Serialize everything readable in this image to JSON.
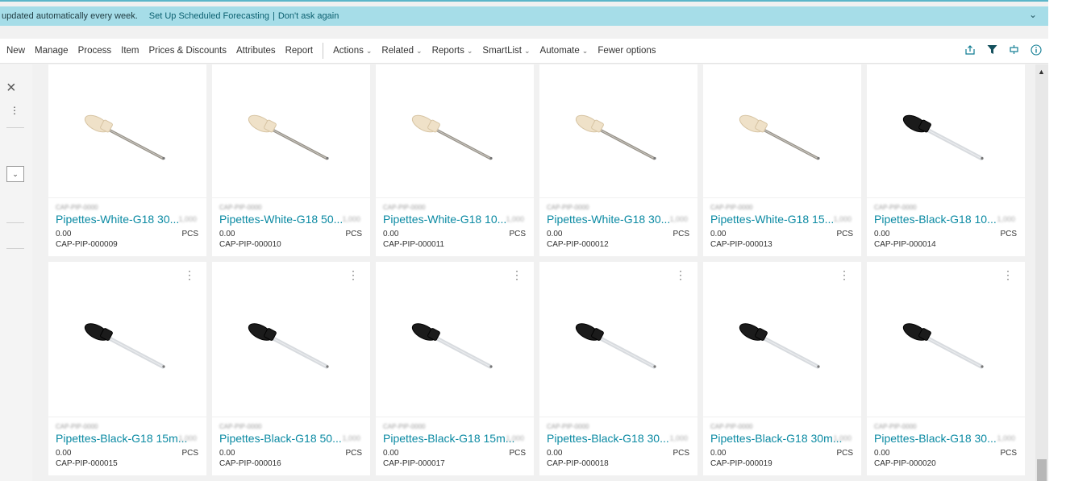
{
  "banner": {
    "message": "updated automatically every week.",
    "setup_link": "Set Up Scheduled Forecasting",
    "divider": "|",
    "dismiss_link": "Don't ask again"
  },
  "actions": {
    "new": "New",
    "manage": "Manage",
    "process": "Process",
    "item": "Item",
    "prices": "Prices & Discounts",
    "attributes": "Attributes",
    "report": "Report",
    "actions_menu": "Actions",
    "related": "Related",
    "reports": "Reports",
    "smartlist": "SmartList",
    "automate": "Automate",
    "fewer": "Fewer options"
  },
  "accent_color": "#0b8aa3",
  "tiles": [
    {
      "description": "Pipettes-White-G18 30...",
      "price": "0.00",
      "uom": "PCS",
      "no": "CAP-PIP-000009",
      "color": "white"
    },
    {
      "description": "Pipettes-White-G18 50...",
      "price": "0.00",
      "uom": "PCS",
      "no": "CAP-PIP-000010",
      "color": "white"
    },
    {
      "description": "Pipettes-White-G18 10...",
      "price": "0.00",
      "uom": "PCS",
      "no": "CAP-PIP-000011",
      "color": "white"
    },
    {
      "description": "Pipettes-White-G18 30...",
      "price": "0.00",
      "uom": "PCS",
      "no": "CAP-PIP-000012",
      "color": "white"
    },
    {
      "description": "Pipettes-White-G18 15...",
      "price": "0.00",
      "uom": "PCS",
      "no": "CAP-PIP-000013",
      "color": "white"
    },
    {
      "description": "Pipettes-Black-G18 10...",
      "price": "0.00",
      "uom": "PCS",
      "no": "CAP-PIP-000014",
      "color": "black"
    },
    {
      "description": "Pipettes-Black-G18 15m...",
      "price": "0.00",
      "uom": "PCS",
      "no": "CAP-PIP-000015",
      "color": "black"
    },
    {
      "description": "Pipettes-Black-G18 50...",
      "price": "0.00",
      "uom": "PCS",
      "no": "CAP-PIP-000016",
      "color": "black"
    },
    {
      "description": "Pipettes-Black-G18 15m...",
      "price": "0.00",
      "uom": "PCS",
      "no": "CAP-PIP-000017",
      "color": "black"
    },
    {
      "description": "Pipettes-Black-G18 30...",
      "price": "0.00",
      "uom": "PCS",
      "no": "CAP-PIP-000018",
      "color": "black"
    },
    {
      "description": "Pipettes-Black-G18 30m...",
      "price": "0.00",
      "uom": "PCS",
      "no": "CAP-PIP-000019",
      "color": "black"
    },
    {
      "description": "Pipettes-Black-G18 30...",
      "price": "0.00",
      "uom": "PCS",
      "no": "CAP-PIP-000020",
      "color": "black"
    }
  ]
}
